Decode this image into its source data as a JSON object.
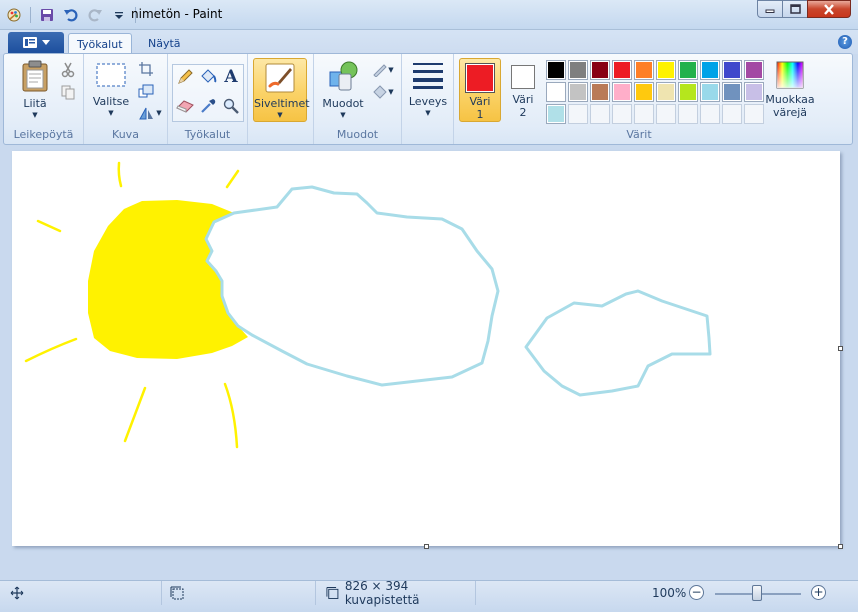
{
  "window": {
    "title": "nimetön - Paint"
  },
  "tabs": [
    {
      "label": "Työkalut"
    },
    {
      "label": "Näytä"
    }
  ],
  "help_label": "?",
  "groups": {
    "clipboard": {
      "label": "Leikepöytä",
      "paste_label": "Liitä"
    },
    "image": {
      "label": "Kuva",
      "select_label": "Valitse"
    },
    "tools": {
      "label": "Työkalut",
      "text_tool_glyph": "A"
    },
    "brushes": {
      "label": "Siveltimet"
    },
    "shapes": {
      "label": "Muodot",
      "shapes_button_label": "Muodot"
    },
    "size": {
      "label": "Leveys"
    },
    "colors": {
      "label": "Värit",
      "color1_label": "Väri\n1",
      "color2_label": "Väri\n2",
      "edit_label": "Muokkaa\nvärejä",
      "color1_value": "#ed1c24",
      "color2_value": "#ffffff",
      "palette": [
        "#000000",
        "#7f7f7f",
        "#880015",
        "#ed1c24",
        "#ff7f27",
        "#fff200",
        "#22b14c",
        "#00a2e8",
        "#3f48cc",
        "#a349a4",
        "#ffffff",
        "#c3c3c3",
        "#b97a57",
        "#ffaec9",
        "#ffc90e",
        "#efe4b0",
        "#b5e61d",
        "#99d9ea",
        "#7092be",
        "#c8bfe7",
        "#b0e0e8",
        "",
        "",
        "",
        "",
        "",
        "",
        "",
        "",
        ""
      ]
    }
  },
  "statusbar": {
    "dimensions": "826 × 394 kuvapistettä",
    "zoom": "100%",
    "zoom_level": 100,
    "zoom_out": "−",
    "zoom_in": "+"
  },
  "drawing": {
    "sun_color": "#fff200",
    "cloud_color": "#a8dce8"
  }
}
